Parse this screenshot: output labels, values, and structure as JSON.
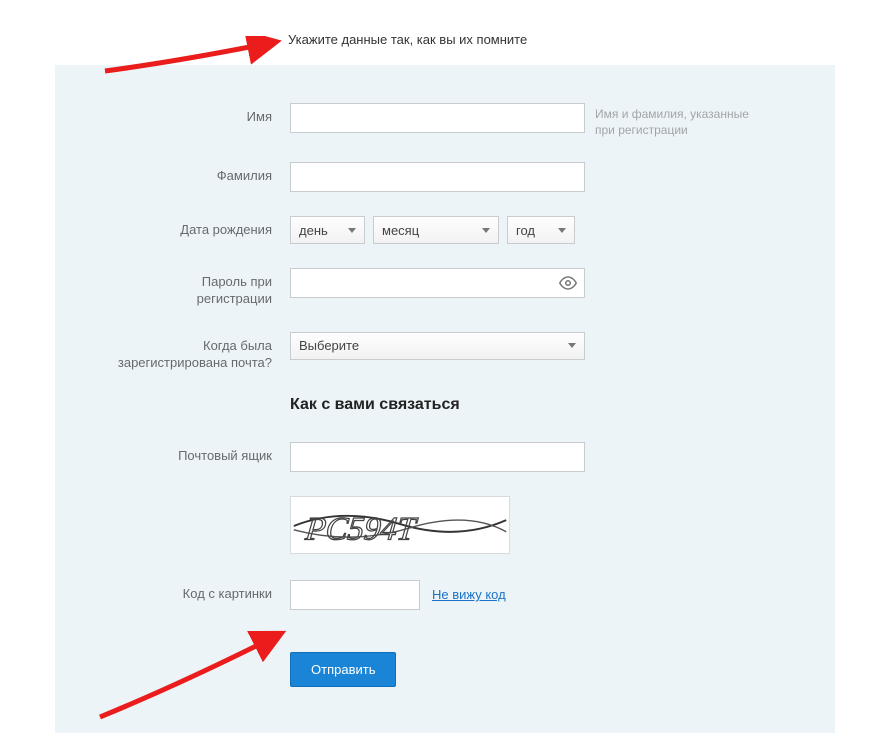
{
  "instruction": "Укажите данные так, как вы их помните",
  "fields": {
    "first_name": {
      "label": "Имя",
      "hint": "Имя и фамилия, указанные при регистрации"
    },
    "last_name": {
      "label": "Фамилия"
    },
    "birth_date": {
      "label": "Дата рождения",
      "day": "день",
      "month": "месяц",
      "year": "год"
    },
    "reg_password": {
      "label_line1": "Пароль при",
      "label_line2": "регистрации"
    },
    "when_registered": {
      "label_line1": "Когда была",
      "label_line2": "зарегистрирована почта?",
      "selected": "Выберите"
    },
    "contact_heading": "Как с вами связаться",
    "mailbox": {
      "label": "Почтовый ящик"
    },
    "captcha_code": {
      "label": "Код с картинки",
      "cant_see": "Не вижу код",
      "captcha_text": "PC594T"
    }
  },
  "submit_label": "Отправить"
}
